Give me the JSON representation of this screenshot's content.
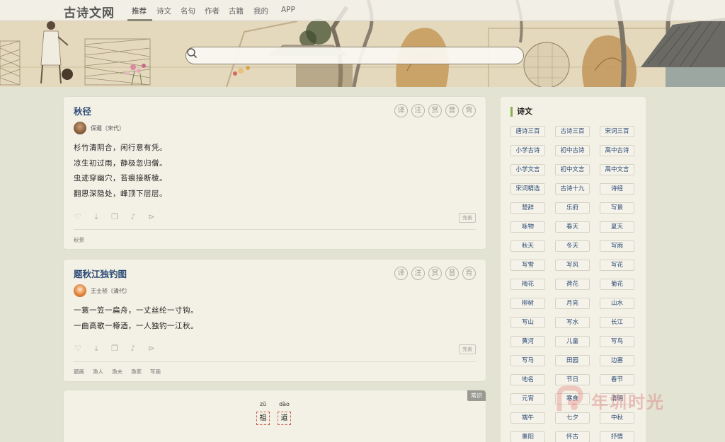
{
  "site": {
    "logo": "古诗文网"
  },
  "nav": {
    "items": [
      {
        "label": "推荐",
        "active": true
      },
      {
        "label": "诗文"
      },
      {
        "label": "名句"
      },
      {
        "label": "作者"
      },
      {
        "label": "古籍"
      },
      {
        "label": "我的"
      },
      {
        "label": "APP"
      }
    ]
  },
  "search": {
    "value": "",
    "placeholder": "",
    "icon": "search-icon"
  },
  "cards": [
    {
      "title": "秋径",
      "tools": [
        "译",
        "注",
        "赏",
        "音",
        "背"
      ],
      "author": "保暹〔宋代〕",
      "lines": [
        "杉竹清阴合，闲行意有凭。",
        "凉生初过雨，静极忽归僧。",
        "虫迹穿幽穴，苔痕接断棱。",
        "翻思深隐处，峰顶下层层。"
      ],
      "complete_label": "完善",
      "tags": [
        "秋景"
      ]
    },
    {
      "title": "题秋江独钓图",
      "tools": [
        "译",
        "注",
        "赏",
        "音",
        "背"
      ],
      "author": "王士祯〔清代〕",
      "lines": [
        "一蓑一笠一扁舟，一丈丝纶一寸钩。",
        "一曲高歌一樽酒，一人独钓一江秋。"
      ],
      "complete_label": "完善",
      "tags": [
        "题画",
        "渔人",
        "渔夫",
        "渔家",
        "写画"
      ]
    }
  ],
  "knowledge": {
    "badge": "常识",
    "chars": [
      {
        "pinyin": "zǔ",
        "hanzi": "祖"
      },
      {
        "pinyin": "dào",
        "hanzi": "道"
      }
    ]
  },
  "sidebar": {
    "title": "诗文",
    "tags": [
      "唐诗三百",
      "古诗三百",
      "宋词三百",
      "小学古诗",
      "初中古诗",
      "高中古诗",
      "小学文言",
      "初中文言",
      "高中文言",
      "宋词精选",
      "古诗十九",
      "诗经",
      "楚辞",
      "乐府",
      "写景",
      "咏物",
      "春天",
      "夏天",
      "秋天",
      "冬天",
      "写雨",
      "写雪",
      "写风",
      "写花",
      "梅花",
      "荷花",
      "菊花",
      "柳树",
      "月亮",
      "山水",
      "写山",
      "写水",
      "长江",
      "黄河",
      "儿童",
      "写鸟",
      "写马",
      "田园",
      "边塞",
      "地名",
      "节日",
      "春节",
      "元宵",
      "寒食",
      "清明",
      "端午",
      "七夕",
      "中秋",
      "重阳",
      "怀古",
      "抒情"
    ]
  },
  "watermark": {
    "text": "年圳时光"
  },
  "colors": {
    "accent_title": "#2b4a75",
    "side_bar_accent": "#8bb04e",
    "page_bg": "#e3e3d3",
    "card_bg": "#f3f1e5"
  }
}
